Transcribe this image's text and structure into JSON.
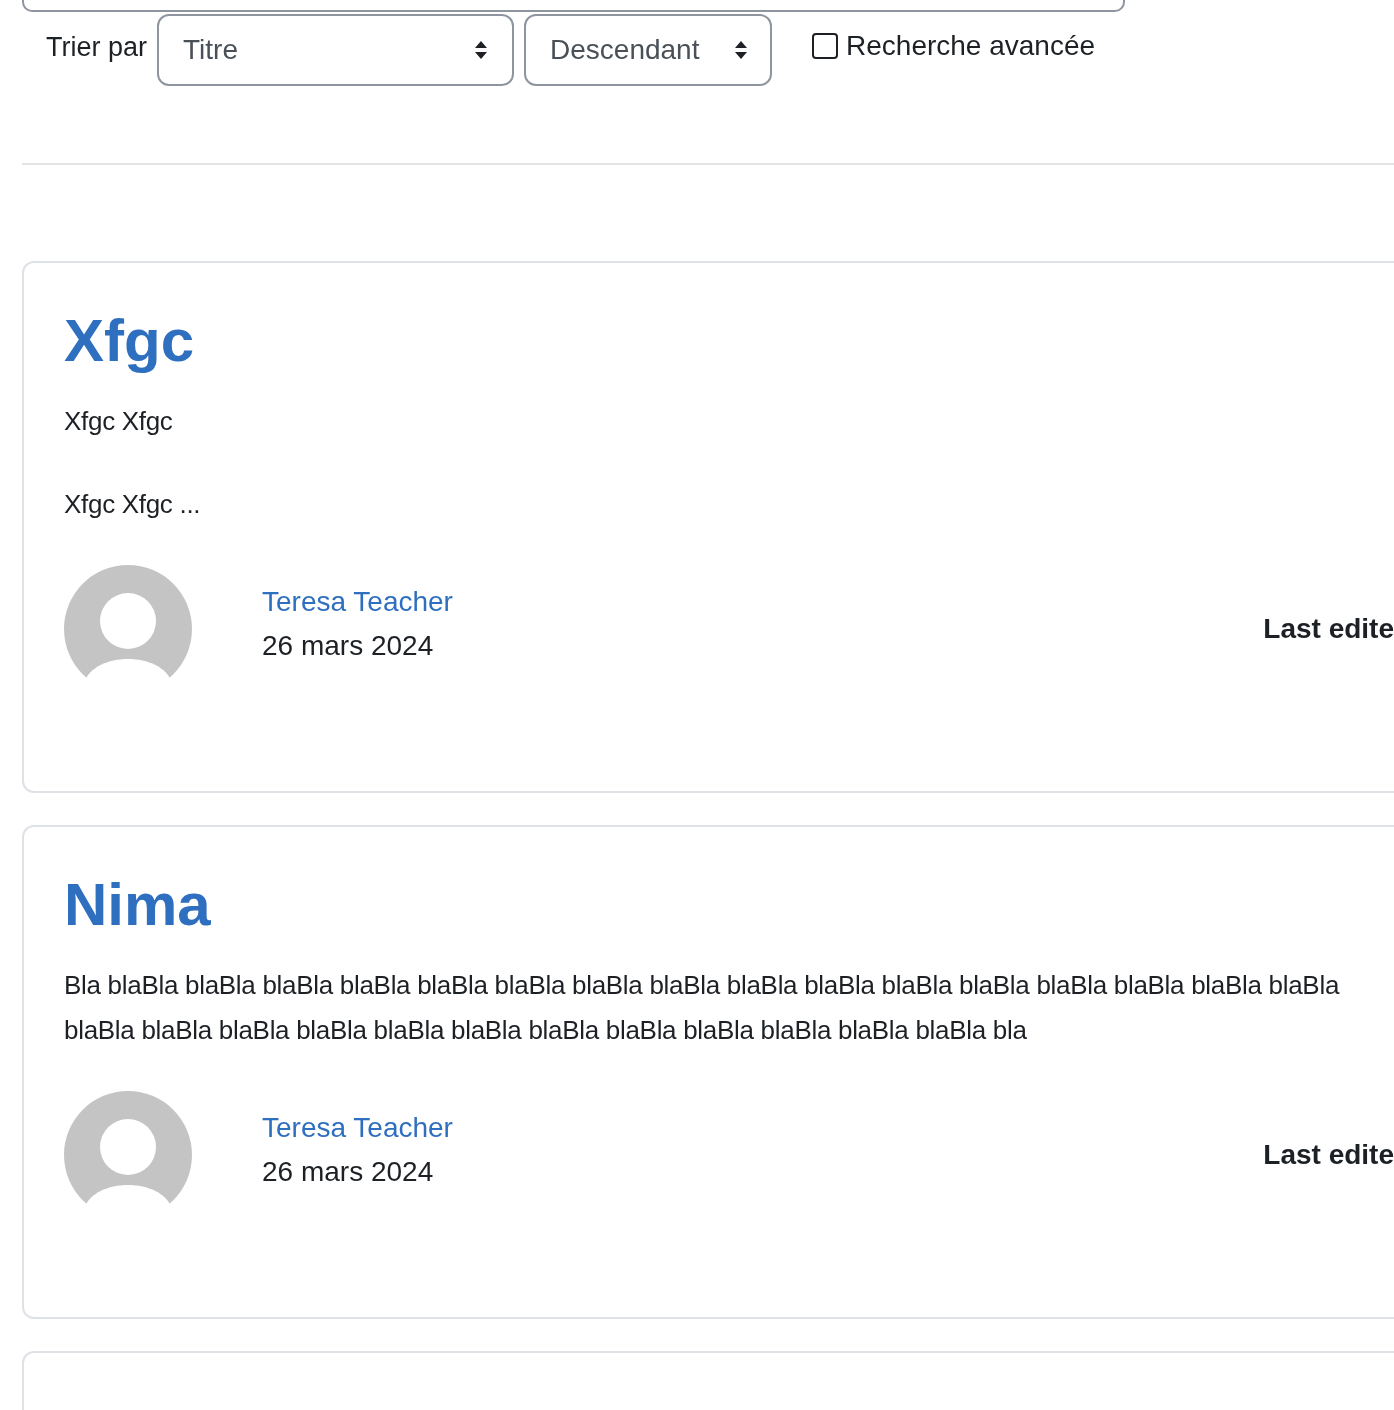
{
  "sort": {
    "label": "Trier par",
    "field": "Titre",
    "order": "Descendant"
  },
  "advanced_search": {
    "label": "Recherche avancée",
    "checked": false
  },
  "entries": [
    {
      "title": "Xfgc",
      "paragraphs": [
        "Xfgc Xfgc",
        "Xfgc Xfgc ..."
      ],
      "author": "Teresa Teacher",
      "date": "26 mars 2024",
      "edited": "Last edite"
    },
    {
      "title": "Nima",
      "paragraphs": [
        "Bla blaBla blaBla blaBla blaBla blaBla blaBla blaBla blaBla blaBla blaBla blaBla blaBla blaBla blaBla blaBla blaBla blaBla blaBla blaBla blaBla blaBla blaBla blaBla blaBla blaBla blaBla blaBla blaBla bla"
      ],
      "author": "Teresa Teacher",
      "date": "26 mars 2024",
      "edited": "Last edite"
    }
  ]
}
